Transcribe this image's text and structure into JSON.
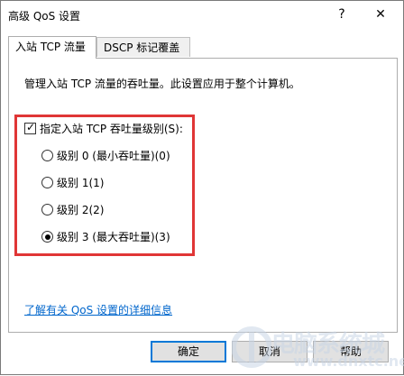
{
  "window": {
    "title": "高级 QoS 设置",
    "help_glyph": "?",
    "close_glyph": "✕"
  },
  "tabs": [
    {
      "label": "入站 TCP 流量",
      "active": true
    },
    {
      "label": "DSCP 标记覆盖",
      "active": false
    }
  ],
  "panel": {
    "description": "管理入站 TCP 流量的吞吐量。此设置应用于整个计算机。",
    "checkbox": {
      "label": "指定入站 TCP 吞吐量级别(S):",
      "checked": true
    },
    "radios": [
      {
        "label": "级别 0 (最小吞吐量)(0)",
        "selected": false
      },
      {
        "label": "级别 1(1)",
        "selected": false
      },
      {
        "label": "级别 2(2)",
        "selected": false
      },
      {
        "label": "级别 3 (最大吞吐量)(3)",
        "selected": true
      }
    ],
    "link": "了解有关 QoS 设置的详细信息"
  },
  "buttons": {
    "ok": "确定",
    "cancel": "取消",
    "help": "帮助"
  },
  "watermark": {
    "text": "电脑系统城",
    "url": "www.dnxtc.net"
  },
  "colors": {
    "highlight_border": "#e03636",
    "link": "#0066cc",
    "default_button_border": "#0078d7"
  }
}
